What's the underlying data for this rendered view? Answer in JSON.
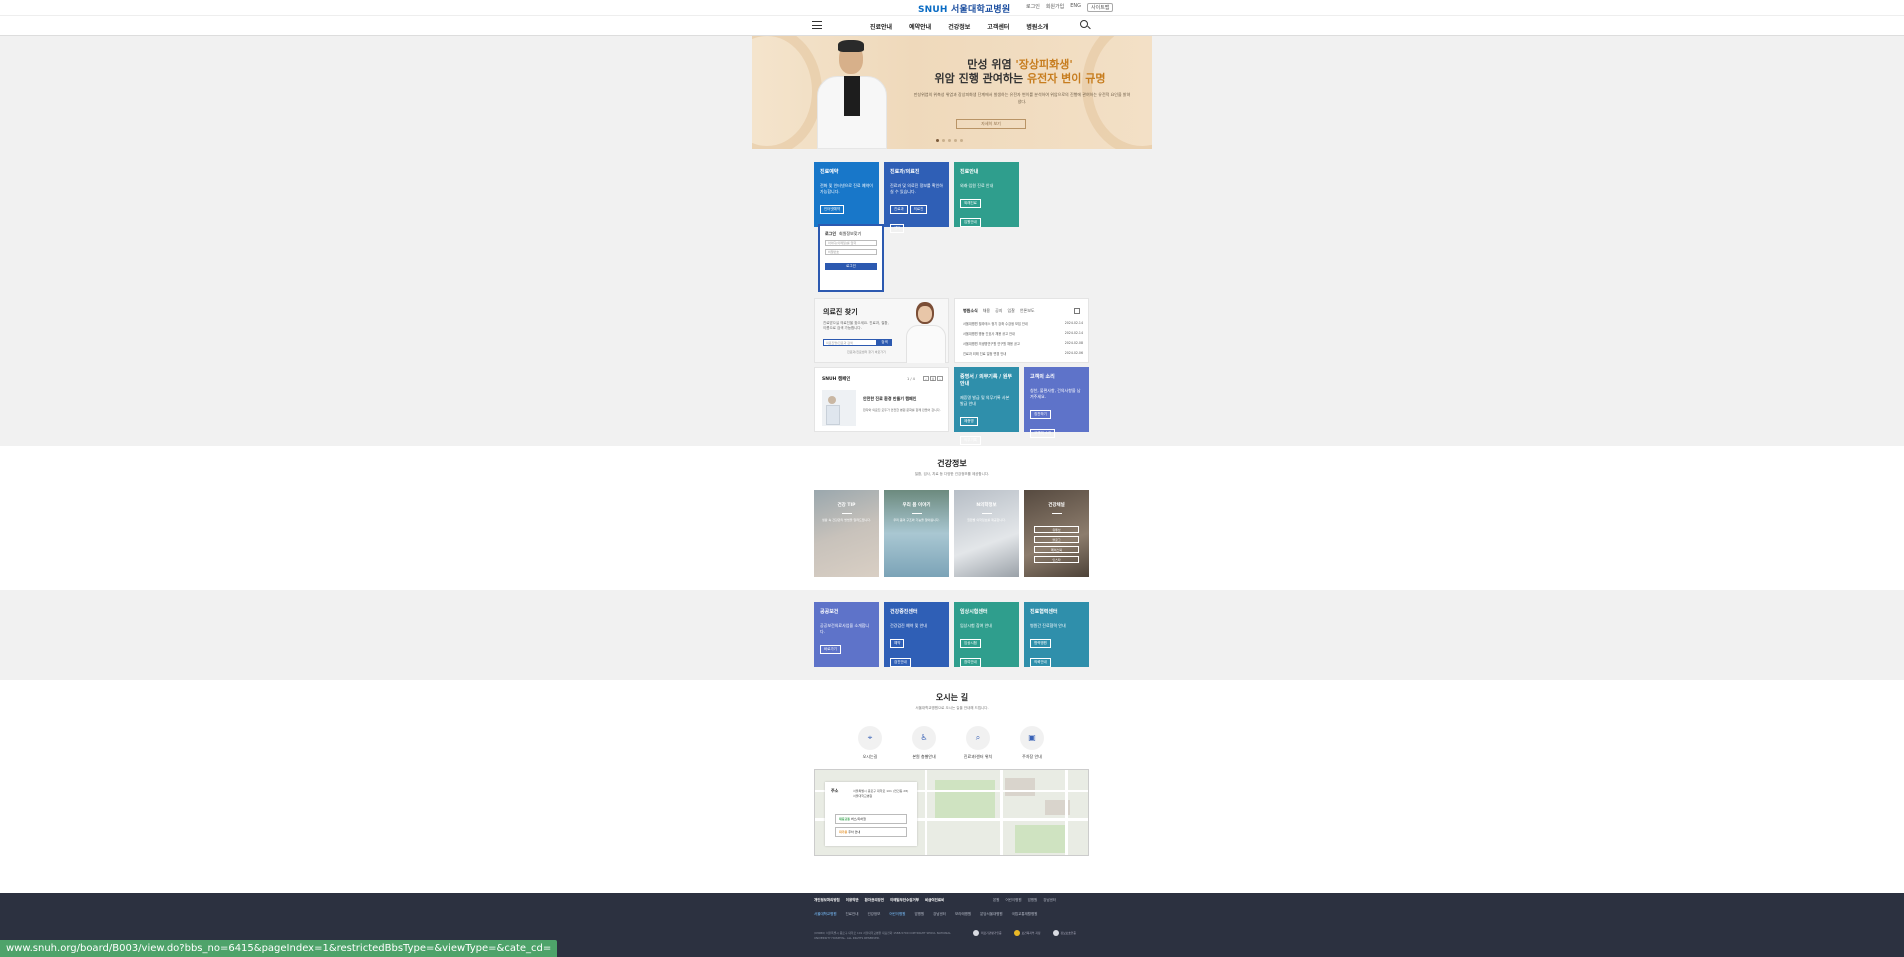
{
  "header": {
    "logo_snuh": "SNUH",
    "logo_text": "서울대학교병원",
    "utils": [
      "로그인",
      "회원가입",
      "ENG"
    ],
    "util_button": "사이트맵",
    "nav": [
      "진료안내",
      "예약안내",
      "건강정보",
      "고객센터",
      "병원소개"
    ]
  },
  "banner": {
    "title1_a": "만성 위염 ",
    "title1_hl": "'장상피화생'",
    "title2_a": "위암 진행 관여하는 ",
    "title2_hl": "유전자 변이 규명",
    "desc": "만성위염의 위축성 위염과 장상피화생 단계에서 발생하는 유전자 변이를 분석하여 위암으로의 진행에 관여하는 유전적 요인을 밝혀냈다.",
    "button": "자세히 보기"
  },
  "quick": {
    "t1_title": "진료예약",
    "t1_desc": "전화 및 인터넷으로 진료 예약이 가능합니다.",
    "t1_b1": "인터넷예약",
    "t1_b2": "전화예약",
    "t2_title": "진료과/의료진",
    "t2_desc": "진료과 및 의료진 정보를 확인하실 수 있습니다.",
    "t2_b1": "진료과",
    "t2_b2": "의료진",
    "t2_b3": "센터",
    "t3_title": "진료안내",
    "t3_desc": "외래·입원 진료 안내",
    "t3_b1": "외래진료",
    "t3_b2": "입원안내"
  },
  "login": {
    "tab1": "로그인",
    "tab2": "회원정보찾기",
    "id_placeholder": "아이디(이메일)를 입력",
    "pw_placeholder": "비밀번호",
    "button": "로그인"
  },
  "finder": {
    "title": "의료진 찾기",
    "desc": "진료받으실 의료진을 찾으세요. 진료과, 질환, 이름으로 검색 가능합니다.",
    "placeholder": "의료진명/진료과 검색",
    "button": "검색",
    "link": "진료과/진료센터 찾기 바로가기"
  },
  "news": {
    "tabs": [
      "병원소식",
      "채용",
      "공지",
      "입찰",
      "언론보도"
    ],
    "items": [
      {
        "title": "서울대병원 필라테스 정기 강좌 수강생 모집 안내",
        "date": "2024.02.14"
      },
      {
        "title": "서울대병원 병동 간호사 채용 공고 안내",
        "date": "2024.02.14"
      },
      {
        "title": "서울대병원 의생명연구원 연구원 채용 공고",
        "date": "2024.02.08"
      },
      {
        "title": "진료과 외래 진료 일정 변경 안내",
        "date": "2024.02.06"
      }
    ]
  },
  "snuh": {
    "title": "SNUH 캠페인",
    "page": "1 / 4",
    "item_title": "안전한 진료 환경 만들기 캠페인",
    "item_desc": "환자와 의료진 모두가 안전한 병원 문화를 함께 만들어 갑니다."
  },
  "small": {
    "s1_title": "증명서 / 의무기록 / 원무안내",
    "s1_desc": "제증명 발급 및 의무기록 사본 발급 안내",
    "s1_b1": "제증명",
    "s1_b2": "의무기록",
    "s2_title": "고객의 소리",
    "s2_desc": "칭찬, 불편사항, 건의사항을 남겨주세요.",
    "s2_b1": "칭찬하기",
    "s2_b2": "고객의 소리"
  },
  "health": {
    "title": "건강정보",
    "sub": "질환, 검사, 치료 등 다양한 건강정보를 제공합니다.",
    "t1": "건강 TIP",
    "t1_desc": "생활 속 건강관리 방법을 알려드립니다.",
    "t2": "우리 몸 이야기",
    "t2_desc": "우리 몸의 구조와 기능을 알아봅니다.",
    "t3": "N의학정보",
    "t3_desc": "질환별 의학정보를 제공합니다.",
    "t4": "건강채널",
    "t4_b": [
      "유튜브",
      "블로그",
      "페이스북",
      "인스타"
    ]
  },
  "programs": {
    "p1_title": "공공보건",
    "p1_desc": "공공보건의료사업을 소개합니다.",
    "p1_b1": "바로가기",
    "p2_title": "건강증진센터",
    "p2_desc": "건강검진 예약 및 안내",
    "p2_b1": "예약",
    "p2_b2": "검진안내",
    "p3_title": "임상시험센터",
    "p3_desc": "임상시험 참여 안내",
    "p3_b1": "임상시험",
    "p3_b2": "참여안내",
    "p4_title": "진료협력센터",
    "p4_desc": "병원간 진료협력 안내",
    "p4_b1": "협력병원",
    "p4_b2": "의뢰안내"
  },
  "location": {
    "title": "오시는 길",
    "sub": "서울대학교병원으로 오시는 길을 안내해 드립니다.",
    "items": [
      "오시는길",
      "본원 층별안내",
      "진료과/센터 위치",
      "주차장 안내"
    ],
    "addr_label": "주소",
    "addr": "서울특별시 종로구 대학로 101 (연건동 28) 서울대학교병원",
    "p1_label": "대중교통",
    "p1": "버스/지하철",
    "p2_label": "자가용",
    "p2": "주차 안내"
  },
  "footer": {
    "r1": [
      "개인정보처리방침",
      "이용약관",
      "환자권리장전",
      "이메일무단수집거부",
      "비급여진료비"
    ],
    "r1b": [
      "본원",
      "어린이병원",
      "암병원",
      "강남센터"
    ],
    "r2": [
      "서울대학교병원",
      "진료안내",
      "건강정보",
      "어린이병원",
      "암병원",
      "강남센터",
      "보라매병원",
      "분당서울대병원",
      "국립교통재활병원"
    ],
    "addr": "(03080) 서울특별시 종로구 대학로 101 서울대학교병원 대표전화 1588-5700 COPYRIGHT SEOUL NATIONAL UNIVERSITY HOSPITAL. ALL RIGHTS RESERVED.",
    "seals": [
      "의료기관평가인증",
      "보건복지부 지정",
      "정보보호인증"
    ]
  },
  "status_url": "www.snuh.org/board/B003/view.do?bbs_no=6415&pageIndex=1&restrictedBbsType=&viewType=&cate_cd="
}
